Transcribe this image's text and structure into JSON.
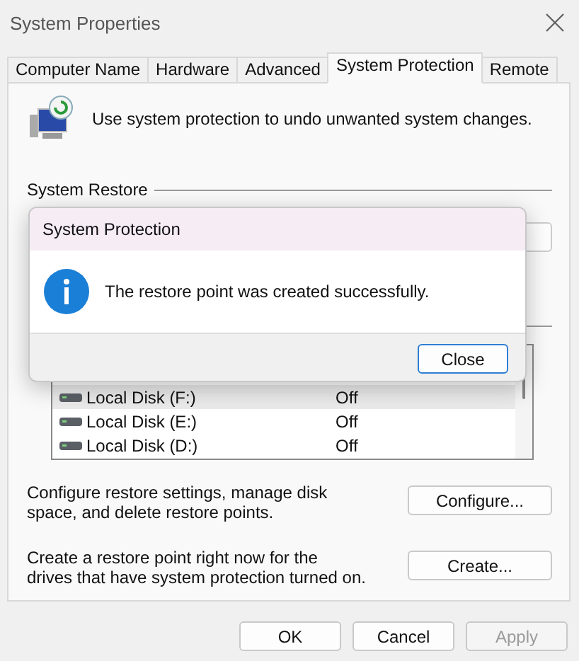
{
  "window": {
    "title": "System Properties"
  },
  "tabs": [
    {
      "label": "Computer Name",
      "selected": false
    },
    {
      "label": "Hardware",
      "selected": false
    },
    {
      "label": "Advanced",
      "selected": false
    },
    {
      "label": "System Protection",
      "selected": true
    },
    {
      "label": "Remote",
      "selected": false
    }
  ],
  "intro": "Use system protection to undo unwanted system changes.",
  "system_restore": {
    "heading": "System Restore"
  },
  "drives": [
    {
      "name": "Local Disk (F:)",
      "protection": "Off",
      "selected": true
    },
    {
      "name": "Local Disk (E:)",
      "protection": "Off",
      "selected": false
    },
    {
      "name": "Local Disk (D:)",
      "protection": "Off",
      "selected": false
    }
  ],
  "configure": {
    "text": "Configure restore settings, manage disk space, and delete restore points.",
    "button": "Configure..."
  },
  "create": {
    "text": "Create a restore point right now for the drives that have system protection turned on.",
    "button": "Create..."
  },
  "buttons": [
    {
      "label": "OK",
      "disabled": false
    },
    {
      "label": "Cancel",
      "disabled": false
    },
    {
      "label": "Apply",
      "disabled": true
    }
  ],
  "dialog": {
    "title": "System Protection",
    "message": "The restore point was created successfully.",
    "button": "Close"
  }
}
